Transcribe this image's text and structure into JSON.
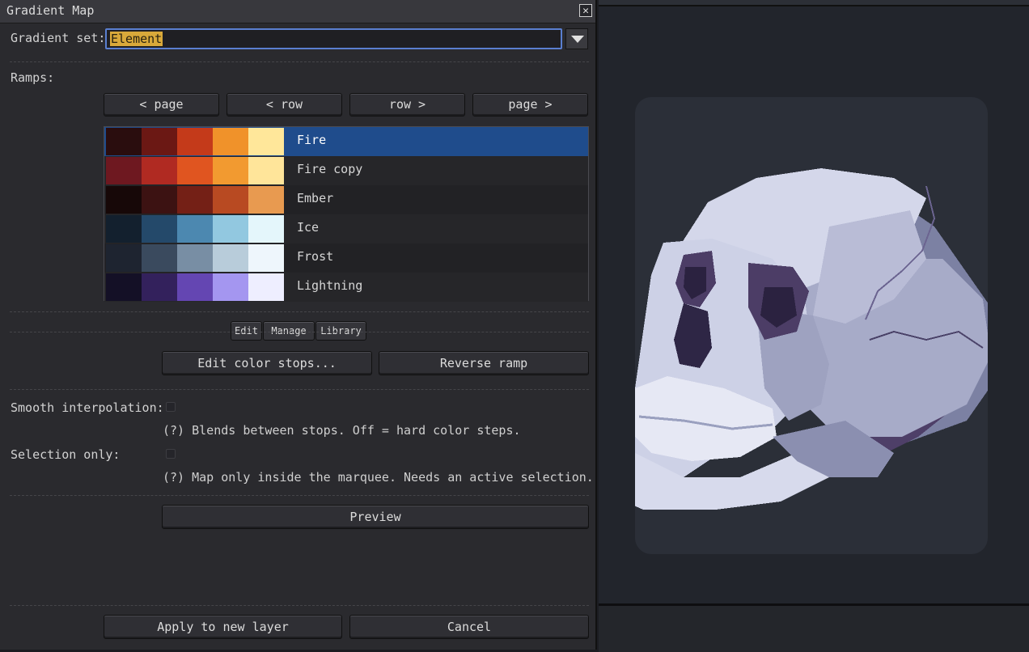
{
  "dialog": {
    "title": "Gradient Map",
    "close_glyph": "✕",
    "gradient_set_label": "Gradient set:",
    "gradient_set_value": "Element",
    "ramps_label": "Ramps:",
    "nav": [
      "< page",
      "< row",
      "row >",
      "page >"
    ],
    "ramps": [
      {
        "name": "Fire",
        "colors": [
          "#2a0d0e",
          "#6b1814",
          "#c43a1a",
          "#f0922a",
          "#ffe79a"
        ]
      },
      {
        "name": "Fire copy",
        "colors": [
          "#6e1820",
          "#b02a22",
          "#e05520",
          "#f29a30",
          "#ffe59a"
        ]
      },
      {
        "name": "Ember",
        "colors": [
          "#170808",
          "#3c1212",
          "#742016",
          "#b84a22",
          "#e89a50"
        ]
      },
      {
        "name": "Ice",
        "colors": [
          "#13202e",
          "#24496a",
          "#4c88b0",
          "#92c8e0",
          "#e4f6fb"
        ]
      },
      {
        "name": "Frost",
        "colors": [
          "#1e2430",
          "#3a4a5e",
          "#788ea4",
          "#b8ccda",
          "#eef6fc"
        ]
      },
      {
        "name": "Lightning",
        "colors": [
          "#141026",
          "#33215c",
          "#6446b2",
          "#a496f0",
          "#eeeeff"
        ]
      }
    ],
    "tabs": [
      "Edit",
      "Manage",
      "Library"
    ],
    "edit_stops": "Edit color stops...",
    "reverse_ramp": "Reverse ramp",
    "smooth_label": "Smooth interpolation:",
    "smooth_help": "(?) Blends between stops. Off = hard color steps.",
    "smooth_checked": false,
    "selection_label": "Selection only:",
    "selection_help": "(?) Map only inside the marquee. Needs an active selection.",
    "selection_checked": false,
    "preview": "Preview",
    "apply": "Apply to new layer",
    "cancel": "Cancel"
  },
  "canvas": {
    "subject": "pixel-art skull",
    "palette": [
      "#cfd3e6",
      "#a6aac8",
      "#7a7fa0",
      "#4a3d62",
      "#2b2240"
    ]
  }
}
